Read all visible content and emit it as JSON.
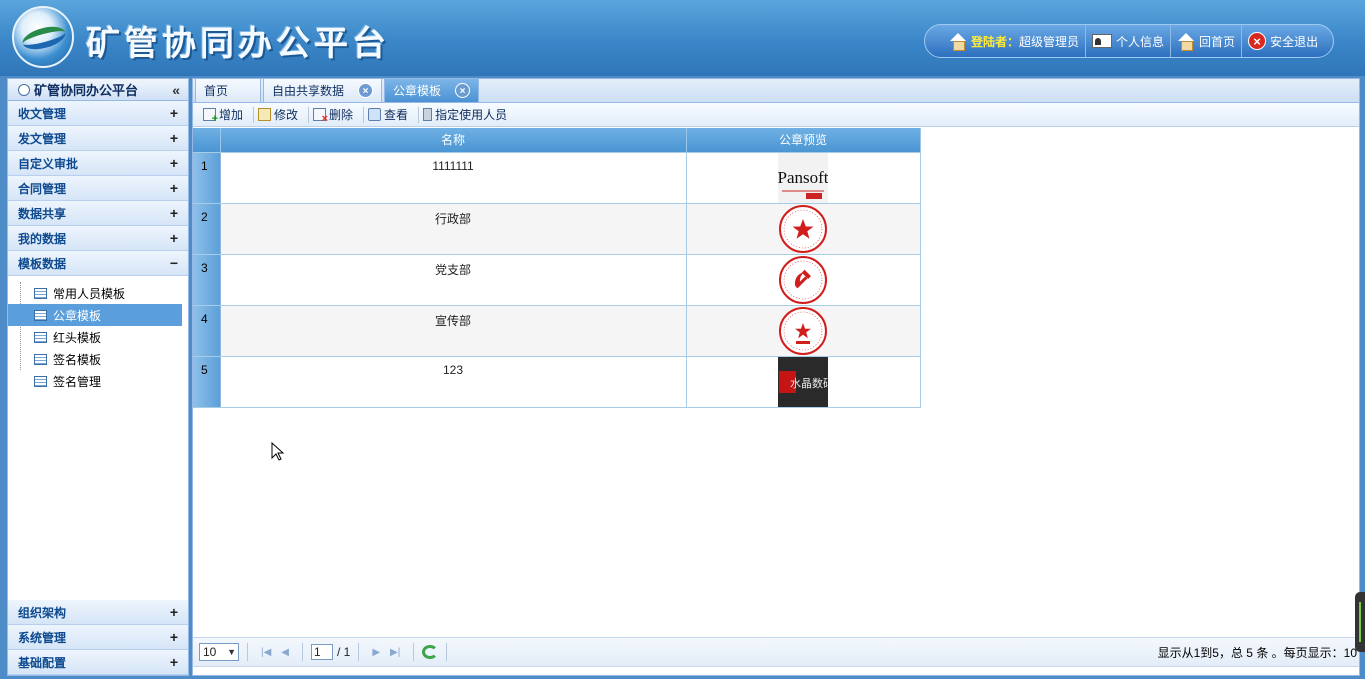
{
  "app": {
    "title": "矿管协同办公平台"
  },
  "topbar": {
    "login_key": "登陆者：",
    "login_user": "超级管理员",
    "profile": "个人信息",
    "home": "回首页",
    "logout": "安全退出"
  },
  "sidebar": {
    "header": "矿管协同办公平台",
    "collapse_glyph": "«",
    "groups_top": [
      {
        "label": "收文管理",
        "toggle": "+"
      },
      {
        "label": "发文管理",
        "toggle": "+"
      },
      {
        "label": "自定义审批",
        "toggle": "+"
      },
      {
        "label": "合同管理",
        "toggle": "+"
      },
      {
        "label": "数据共享",
        "toggle": "+"
      },
      {
        "label": "我的数据",
        "toggle": "+"
      },
      {
        "label": "模板数据",
        "toggle": "−"
      }
    ],
    "tree": [
      {
        "label": "常用人员模板"
      },
      {
        "label": "公章模板"
      },
      {
        "label": "红头模板"
      },
      {
        "label": "签名模板"
      },
      {
        "label": "签名管理"
      }
    ],
    "groups_bottom": [
      {
        "label": "组织架构",
        "toggle": "+"
      },
      {
        "label": "系统管理",
        "toggle": "+"
      },
      {
        "label": "基础配置",
        "toggle": "+"
      }
    ]
  },
  "tabs": [
    {
      "label": "首页"
    },
    {
      "label": "自由共享数据"
    },
    {
      "label": "公章模板"
    }
  ],
  "toolbar": {
    "add": "增加",
    "edit": "修改",
    "delete": "删除",
    "view": "查看",
    "assign": "指定使用人员"
  },
  "grid": {
    "columns": [
      "名称",
      "公章预览"
    ],
    "rows": [
      {
        "num": "1",
        "name": "1111111",
        "seal": "Pansoft"
      },
      {
        "num": "2",
        "name": "行政部",
        "seal": "red-star-seal"
      },
      {
        "num": "3",
        "name": "党支部",
        "seal": "hammer-sickle-seal"
      },
      {
        "num": "4",
        "name": "宣传部",
        "seal": "red-star-seal-small"
      },
      {
        "num": "5",
        "name": "123",
        "seal": "水晶数码"
      }
    ]
  },
  "pager": {
    "page_size": "10",
    "page": "1",
    "total_pages": "/ 1",
    "info": "显示从1到5，总 5 条 。每页显示：10"
  }
}
